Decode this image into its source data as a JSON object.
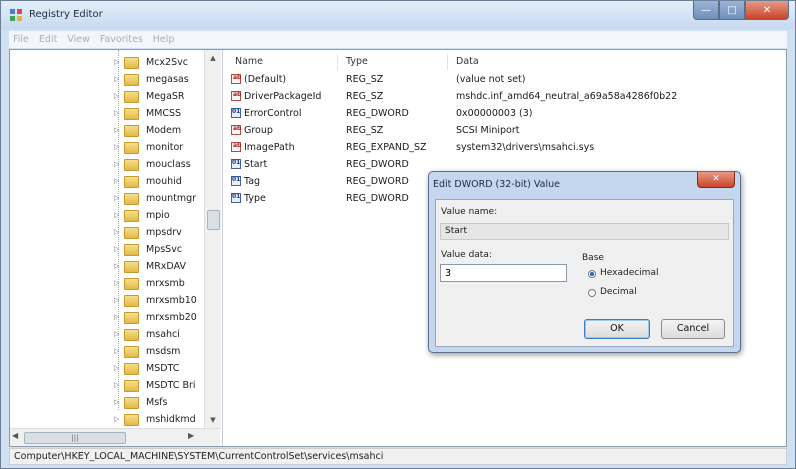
{
  "window": {
    "title": "Registry Editor"
  },
  "menu": [
    "File",
    "Edit",
    "View",
    "Favorites",
    "Help"
  ],
  "tree": {
    "items": [
      "Mcx2Svc",
      "megasas",
      "MegaSR",
      "MMCSS",
      "Modem",
      "monitor",
      "mouclass",
      "mouhid",
      "mountmgr",
      "mpio",
      "mpsdrv",
      "MpsSvc",
      "MRxDAV",
      "mrxsmb",
      "mrxsmb10",
      "mrxsmb20",
      "msahci",
      "msdsm",
      "MSDTC",
      "MSDTC Bri",
      "Msfs",
      "mshidkmd"
    ]
  },
  "list": {
    "headers": {
      "name": "Name",
      "type": "Type",
      "data": "Data"
    },
    "rows": [
      {
        "name": "(Default)",
        "type": "REG_SZ",
        "data": "(value not set)",
        "icon": "string-value-icon"
      },
      {
        "name": "DriverPackageId",
        "type": "REG_SZ",
        "data": "mshdc.inf_amd64_neutral_a69a58a4286f0b22",
        "icon": "string-value-icon"
      },
      {
        "name": "ErrorControl",
        "type": "REG_DWORD",
        "data": "0x00000003 (3)",
        "icon": "dword-value-icon"
      },
      {
        "name": "Group",
        "type": "REG_SZ",
        "data": "SCSI Miniport",
        "icon": "string-value-icon"
      },
      {
        "name": "ImagePath",
        "type": "REG_EXPAND_SZ",
        "data": "system32\\drivers\\msahci.sys",
        "icon": "string-value-icon"
      },
      {
        "name": "Start",
        "type": "REG_DWORD",
        "data": "",
        "icon": "dword-value-icon"
      },
      {
        "name": "Tag",
        "type": "REG_DWORD",
        "data": "",
        "icon": "dword-value-icon"
      },
      {
        "name": "Type",
        "type": "REG_DWORD",
        "data": "",
        "icon": "dword-value-icon"
      }
    ]
  },
  "status": {
    "path": "Computer\\HKEY_LOCAL_MACHINE\\SYSTEM\\CurrentControlSet\\services\\msahci"
  },
  "dialog": {
    "title": "Edit DWORD (32-bit) Value",
    "value_name_label": "Value name:",
    "value_name": "Start",
    "value_data_label": "Value data:",
    "value_data": "3",
    "base_label": "Base",
    "hex_label": "Hexadecimal",
    "dec_label": "Decimal",
    "base_selected": "Hexadecimal",
    "ok_label": "OK",
    "cancel_label": "Cancel"
  },
  "colors": {
    "title_bar": "#c7d9ef",
    "close_button": "#c9452a",
    "folder": "#e3b84a"
  }
}
